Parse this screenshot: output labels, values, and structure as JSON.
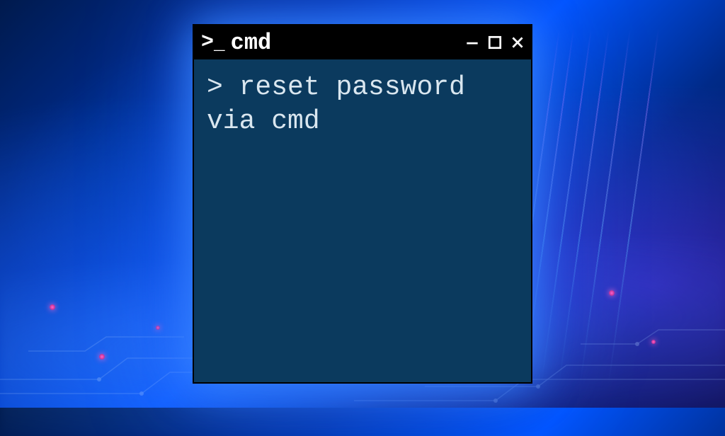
{
  "window": {
    "title": "cmd"
  },
  "terminal": {
    "prompt": ">",
    "command": "reset password via cmd"
  },
  "colors": {
    "titlebar_bg": "#000000",
    "terminal_bg": "#0b3a5e",
    "text": "#d9e6ef",
    "glow": "#3c8cff"
  }
}
